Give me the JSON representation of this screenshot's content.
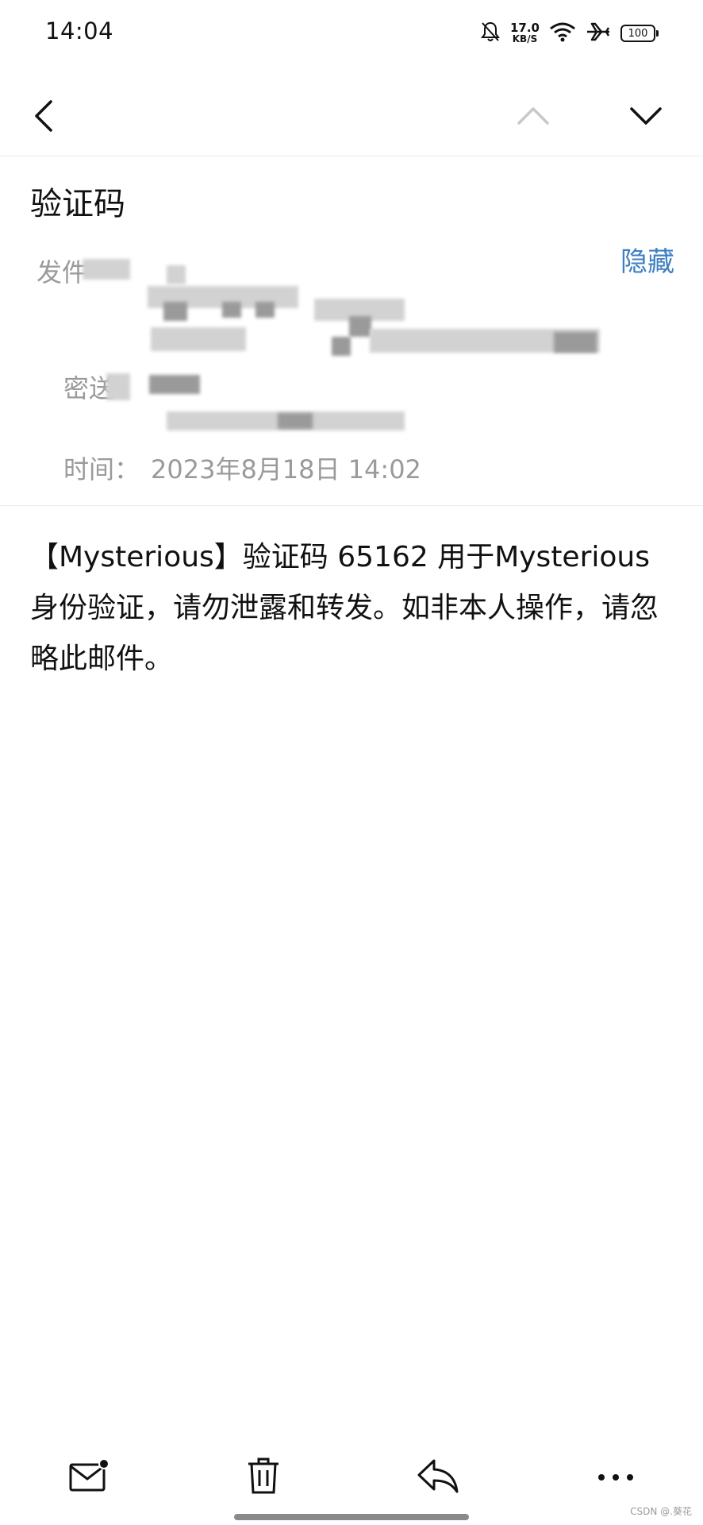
{
  "status_bar": {
    "time": "14:04",
    "net_speed_value": "17.0",
    "net_speed_unit": "KB/S",
    "battery": "100",
    "icons": [
      "bell-muted-icon",
      "wifi-icon",
      "airplane-icon",
      "battery-icon"
    ]
  },
  "nav": {
    "icons": [
      "chevron-left-icon",
      "chevron-up-icon",
      "chevron-down-icon"
    ]
  },
  "email": {
    "subject": "验证码",
    "hide_label": "隐藏",
    "from_label": "发件",
    "bcc_label": "密送",
    "time_label": "时间：",
    "time_value": "2023年8月18日 14:02",
    "body": "【Mysterious】验证码 65162 用于Mysterious身份验证，请勿泄露和转发。如非本人操作，请忽略此邮件。"
  },
  "toolbar": {
    "icons": [
      "mail-unread-icon",
      "trash-icon",
      "reply-icon",
      "more-icon"
    ]
  },
  "watermark": "CSDN @.葵花",
  "colors": {
    "link": "#3f7fc1",
    "meta_text": "#9a9a9a",
    "divider": "#ececec"
  }
}
